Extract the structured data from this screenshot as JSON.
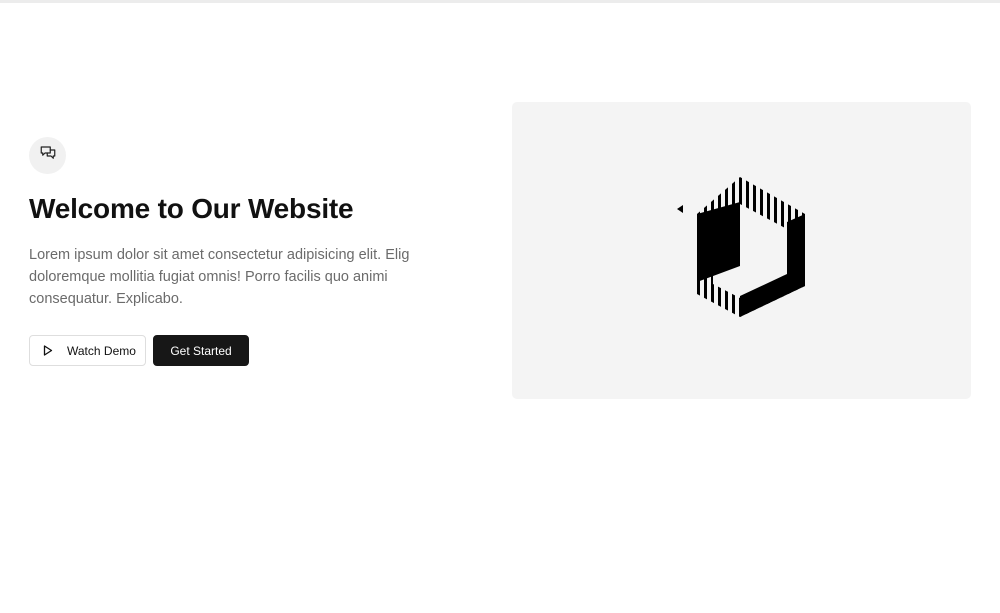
{
  "hero": {
    "icon": "chat-bubbles-icon",
    "title": "Welcome to Our Website",
    "description": "Lorem ipsum dolor sit amet consectetur adipisicing elit. Elig doloremque mollitia fugiat omnis! Porro facilis quo animi consequatur. Explicabo.",
    "watch_demo_label": "Watch Demo",
    "watch_demo_icon": "play-icon",
    "get_started_label": "Get Started"
  },
  "media": {
    "logo": "striped-hexagon-logo"
  },
  "colors": {
    "primary_button": "#171717",
    "media_background": "#f4f4f4",
    "body_text": "#6b6b6b"
  }
}
